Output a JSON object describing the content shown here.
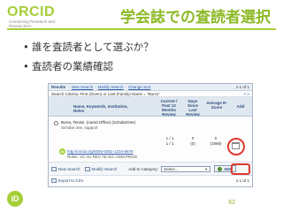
{
  "slide": {
    "logo_word": "ORCID",
    "logo_tagline": "Connecting Research and Researchers",
    "title": "学会誌での査読者選択",
    "bullets": [
      "誰を査読者として選ぶか？",
      "査読者の業績確認"
    ],
    "page_number": "62",
    "id_logo": "iD",
    "accent_color": "#a6ce39"
  },
  "screenshot": {
    "topbar": {
      "results_label": "Results",
      "links": [
        "New Search",
        "Modify Search",
        "Change Sort"
      ],
      "count": "1-1 of 1"
    },
    "criteria": {
      "text": "Search Criteria: First (Given) or Last (Family) Name = \"Burra\"",
      "nav": "< >"
    },
    "columns": {
      "name": "Name, Keywords, Institution, Roles",
      "reviews": "Current / Past 12 Months Review",
      "days": "Days Since Last Review",
      "score": "Average R-Score",
      "add": "Add"
    },
    "row": {
      "name": "Burra, Tenise. (cared Office) (ScholarOne)",
      "sub": "Scholar one, support",
      "orcid_url": "http://orcid.org/0000-0002-1234-5678",
      "roles": "Roles: VC AU REV AE EIC ADM PROD",
      "reviews": [
        "1 / 1",
        "1 / 1"
      ],
      "days": [
        "0",
        "(0)"
      ],
      "score": [
        "0",
        "(1869)"
      ]
    },
    "actions": {
      "new_search": "New Search",
      "modify_search": "Modify Search",
      "add_to_category_label": "Add to Category:",
      "category_select": "Select...",
      "add_button": "ADD"
    },
    "footer": {
      "export": "Export to CSV",
      "count": "1-1 of 1"
    }
  }
}
